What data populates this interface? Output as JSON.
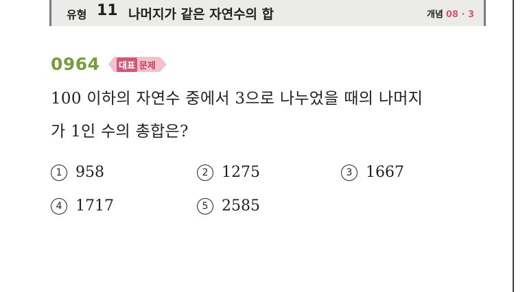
{
  "header": {
    "type_label": "유형",
    "type_number": "11",
    "title": "나머지가 같은 자연수의 합",
    "concept_label": "개념",
    "concept_ref": "08 · 3"
  },
  "problem": {
    "number": "0964",
    "badge_part1": "대표",
    "badge_part2": "문제",
    "question_line1": "100 이하의 자연수 중에서 3으로 나누었을 때의 나머지",
    "question_line2": "가 1인 수의 총합은?",
    "choices": [
      {
        "marker": "1",
        "value": "958"
      },
      {
        "marker": "2",
        "value": "1275"
      },
      {
        "marker": "3",
        "value": "1667"
      },
      {
        "marker": "4",
        "value": "1717"
      },
      {
        "marker": "5",
        "value": "2585"
      }
    ]
  }
}
